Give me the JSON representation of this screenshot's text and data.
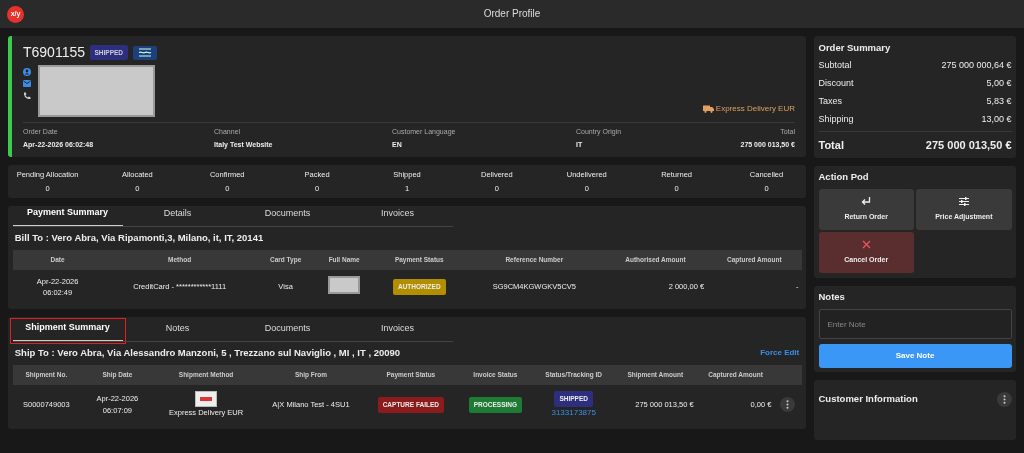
{
  "app": {
    "logo": "x/y",
    "title": "Order Profile"
  },
  "order": {
    "id": "T6901155",
    "status": {
      "label": "SHIPPED",
      "color": "#2e2e7e"
    },
    "delivery": "Express Delivery EUR",
    "fields": [
      {
        "label": "Order Date",
        "value": "Apr-22-2026 06:02:48"
      },
      {
        "label": "Channel",
        "value": "Italy Test Website"
      },
      {
        "label": "Customer Language",
        "value": "EN"
      },
      {
        "label": "Country Origin",
        "value": "IT"
      },
      {
        "label": "Total",
        "value": "275 000 013,50 €"
      }
    ]
  },
  "status_counts": [
    {
      "label": "Pending Allocation",
      "value": "0"
    },
    {
      "label": "Allocated",
      "value": "0"
    },
    {
      "label": "Confirmed",
      "value": "0"
    },
    {
      "label": "Packed",
      "value": "0"
    },
    {
      "label": "Shipped",
      "value": "1"
    },
    {
      "label": "Delivered",
      "value": "0"
    },
    {
      "label": "Undelivered",
      "value": "0"
    },
    {
      "label": "Returned",
      "value": "0"
    },
    {
      "label": "Cancelled",
      "value": "0"
    }
  ],
  "payment": {
    "tabs": [
      {
        "label": "Payment Summary",
        "selected": true
      },
      {
        "label": "Details",
        "selected": false
      },
      {
        "label": "Documents",
        "selected": false
      },
      {
        "label": "Invoices",
        "selected": false
      }
    ],
    "bill_to": "Bill To : Vero Abra, Via Ripamonti,3, Milano, it, IT, 20141",
    "columns": [
      "Date",
      "Method",
      "Card Type",
      "Full Name",
      "Payment Status",
      "Reference Number",
      "Authorised Amount",
      "Captured Amount"
    ],
    "rows": [
      [
        {
          "kind": "datetime",
          "text": "Apr-22-2026 06:02:49"
        },
        {
          "kind": "text",
          "text": "CreditCard - ************1111"
        },
        {
          "kind": "text",
          "text": "Visa"
        },
        {
          "kind": "redacted"
        },
        {
          "kind": "badge",
          "text": "AUTHORIZED",
          "color": "#b38f00"
        },
        {
          "kind": "text",
          "text": "SG9CM4KGWGKV5CV5"
        },
        {
          "kind": "amount",
          "text": "2 000,00 €"
        },
        {
          "kind": "amount",
          "text": "-"
        }
      ]
    ]
  },
  "shipment": {
    "tabs": [
      {
        "label": "Shipment Summary",
        "selected": true,
        "highlighted": true
      },
      {
        "label": "Notes",
        "selected": false,
        "highlighted": false
      },
      {
        "label": "Documents",
        "selected": false,
        "highlighted": false
      },
      {
        "label": "Invoices",
        "selected": false,
        "highlighted": false
      }
    ],
    "ship_to": "Ship To : Vero Abra, Via Alessandro Manzoni, 5 , Trezzano sul Naviglio , MI , IT , 20090",
    "force_edit": "Force Edit",
    "columns": [
      "Shipment No.",
      "Ship Date",
      "Shipment Method",
      "Ship From",
      "Payment Status",
      "Invoice Status",
      "Status/Tracking ID",
      "Shipment Amount",
      "Captured Amount"
    ],
    "rows": [
      [
        {
          "kind": "text",
          "text": "S0000749003"
        },
        {
          "kind": "datetime",
          "text": "Apr-22-2026 06:07:09"
        },
        {
          "kind": "method",
          "text": "Express Delivery EUR"
        },
        {
          "kind": "text",
          "text": "A|X Milano Test - 4SU1"
        },
        {
          "kind": "badge",
          "text": "CAPTURE FAILED",
          "color": "#8c1c1c"
        },
        {
          "kind": "badge",
          "text": "PROCESSING",
          "color": "#1e7b34"
        },
        {
          "kind": "tracking",
          "text": "SHIPPED",
          "color": "#2e2e7e",
          "link": "3133173875"
        },
        {
          "kind": "amount",
          "text": "275 000 013,50 €"
        },
        {
          "kind": "amount",
          "text": "0,00 €"
        },
        {
          "kind": "menu"
        }
      ]
    ]
  },
  "order_summary": {
    "title": "Order Summary",
    "lines": [
      {
        "label": "Subtotal",
        "value": "275 000 000,64 €"
      },
      {
        "label": "Discount",
        "value": "5,00 €"
      },
      {
        "label": "Taxes",
        "value": "5,83 €"
      },
      {
        "label": "Shipping",
        "value": "13,00 €"
      }
    ],
    "total": {
      "label": "Total",
      "value": "275 000 013,50 €"
    }
  },
  "action_pod": {
    "title": "Action Pod",
    "actions": [
      {
        "label": "Return Order",
        "kind": "return"
      },
      {
        "label": "Price Adjustment",
        "kind": "adjust"
      },
      {
        "label": "Cancel Order",
        "kind": "cancel"
      }
    ]
  },
  "notes": {
    "title": "Notes",
    "placeholder": "Enter Note",
    "button": "Save Note"
  },
  "customer_info": {
    "title": "Customer Information"
  }
}
